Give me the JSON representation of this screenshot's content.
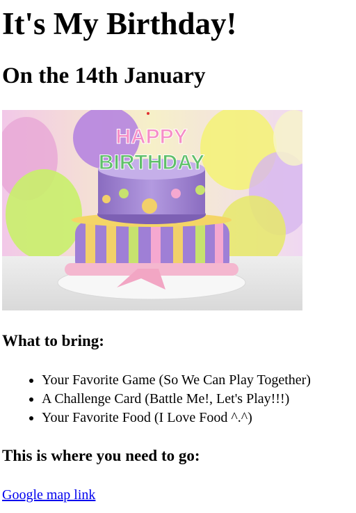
{
  "page": {
    "title": "It's My Birthday!",
    "subtitle": "On the 14th January"
  },
  "hero_image": {
    "cake_topper_line1": "HAPPY",
    "cake_topper_line2": "BIRTHDAY"
  },
  "bring_section": {
    "heading": "What to bring:",
    "items": [
      "Your Favorite Game (So We Can Play Together)",
      "A Challenge Card (Battle Me!, Let's Play!!!)",
      "Your Favorite Food (I Love Food ^.^)"
    ]
  },
  "location_section": {
    "heading": "This is where you need to go:",
    "link_text": "Google map link"
  },
  "colors": {
    "link": "#0000ee",
    "text": "#000000",
    "background": "#ffffff"
  }
}
